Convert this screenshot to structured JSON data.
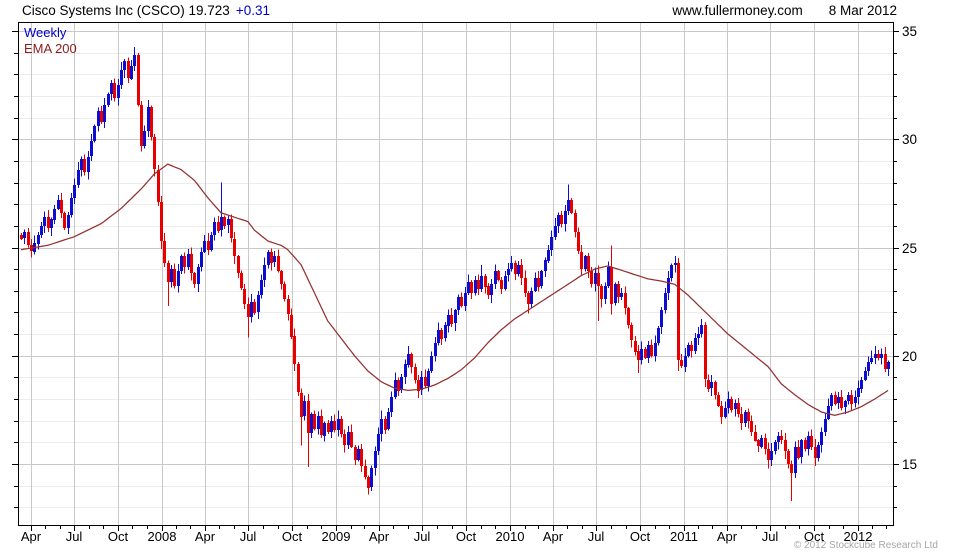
{
  "header": {
    "title": "Cisco Systems Inc (CSCO) 19.723",
    "change": "+0.31",
    "site": "www.fullermoney.com",
    "date": "8 Mar 2012"
  },
  "legend": {
    "timeframe": "Weekly",
    "indicator": "EMA 200"
  },
  "footer": {
    "copyright": "© 2012 Stockcube Research Ltd"
  },
  "colors": {
    "up": "#0d0dd2",
    "down": "#e80000",
    "ema": "#943030",
    "grid_major": "#c9c9c9",
    "grid_minor": "#ececec",
    "frame": "#000000",
    "axis_text": "#000000",
    "change_text": "#0000cc",
    "legend_weekly": "#0000cc",
    "legend_ema": "#8b1a1a",
    "copyright_text": "#a6a6a6"
  },
  "chart_data": {
    "type": "candlestick+line",
    "title": "Cisco Systems Inc (CSCO)",
    "last_price": 19.723,
    "change": 0.31,
    "frequency": "weekly",
    "start_date": "2007-03-12",
    "end_date": "2012-03-08",
    "ylim": [
      12.2,
      35.4
    ],
    "y_major_ticks": [
      15,
      20,
      25,
      30,
      35
    ],
    "y_minor_step": 1,
    "x_quarter_labels": [
      "Apr",
      "Jul",
      "Oct",
      "2008",
      "Apr",
      "Jul",
      "Oct",
      "2009",
      "Apr",
      "Jul",
      "Oct",
      "2010",
      "Apr",
      "Jul",
      "Oct",
      "2011",
      "Apr",
      "Jul",
      "Oct",
      "2012"
    ],
    "legend_series": [
      "Weekly",
      "EMA 200"
    ],
    "first_open": 25.6,
    "weekly_closes": [
      25.4,
      25.7,
      25.1,
      24.8,
      25.2,
      25.6,
      26.0,
      26.4,
      25.9,
      26.3,
      26.8,
      27.2,
      26.6,
      25.9,
      26.5,
      27.3,
      27.9,
      28.6,
      29.1,
      28.5,
      29.2,
      29.9,
      30.6,
      31.3,
      30.8,
      31.6,
      32.1,
      32.6,
      31.9,
      32.5,
      33.2,
      33.6,
      32.8,
      33.4,
      33.9,
      31.6,
      29.7,
      30.4,
      31.5,
      30.1,
      28.6,
      27.1,
      25.3,
      24.3,
      23.4,
      24.0,
      23.2,
      23.9,
      24.6,
      24.1,
      24.7,
      23.8,
      23.3,
      24.1,
      24.8,
      25.3,
      24.9,
      25.6,
      26.2,
      25.8,
      26.4,
      26.0,
      26.3,
      25.4,
      24.6,
      23.8,
      23.1,
      22.4,
      21.8,
      22.5,
      22.0,
      22.8,
      23.5,
      24.2,
      24.8,
      24.3,
      24.6,
      23.9,
      23.3,
      22.6,
      21.9,
      20.9,
      19.6,
      18.3,
      17.2,
      17.9,
      16.4,
      17.3,
      16.6,
      17.2,
      16.3,
      16.9,
      16.5,
      17.0,
      16.6,
      17.1,
      16.4,
      15.9,
      16.5,
      15.8,
      15.2,
      15.7,
      14.9,
      14.4,
      13.9,
      14.8,
      15.6,
      16.4,
      17.1,
      16.6,
      17.4,
      18.1,
      18.9,
      18.4,
      19.0,
      19.6,
      20.1,
      19.5,
      18.9,
      18.4,
      19.0,
      18.6,
      19.3,
      20.0,
      20.6,
      21.2,
      20.8,
      21.4,
      21.9,
      21.5,
      22.1,
      22.7,
      22.3,
      22.9,
      23.4,
      22.9,
      23.5,
      23.1,
      23.7,
      23.2,
      22.8,
      23.3,
      23.9,
      23.5,
      23.1,
      23.7,
      24.0,
      24.3,
      23.8,
      24.2,
      23.6,
      22.9,
      22.4,
      23.0,
      23.6,
      23.2,
      23.9,
      24.4,
      24.9,
      25.5,
      26.0,
      26.5,
      26.1,
      26.7,
      27.2,
      26.6,
      25.7,
      24.8,
      24.0,
      24.6,
      23.9,
      23.3,
      23.8,
      23.2,
      22.6,
      23.2,
      24.1,
      22.4,
      23.3,
      22.7,
      22.9,
      22.2,
      21.4,
      20.7,
      20.2,
      19.8,
      20.3,
      19.9,
      20.5,
      20.0,
      20.6,
      21.3,
      22.1,
      22.9,
      23.6,
      24.2,
      24.3,
      19.8,
      19.5,
      20.0,
      20.5,
      20.2,
      20.8,
      21.0,
      21.4,
      18.9,
      18.5,
      18.8,
      18.2,
      17.7,
      17.2,
      17.6,
      18.0,
      17.5,
      17.8,
      17.3,
      16.9,
      17.4,
      17.0,
      16.5,
      16.1,
      15.8,
      16.2,
      15.7,
      15.2,
      15.6,
      16.0,
      16.3,
      16.1,
      15.6,
      15.0,
      14.6,
      15.8,
      15.3,
      16.1,
      15.7,
      16.3,
      15.8,
      15.3,
      15.9,
      16.5,
      17.1,
      17.7,
      18.2,
      17.8,
      18.1,
      17.6,
      17.9,
      18.2,
      17.8,
      18.1,
      18.5,
      18.9,
      19.3,
      19.7,
      19.9,
      20.1,
      19.9,
      20.1,
      19.4,
      19.723
    ],
    "wick_overrides": {
      "34": {
        "h": 34.25
      },
      "44": {
        "l": 22.3
      },
      "60": {
        "h": 28.0
      },
      "68": {
        "l": 20.85
      },
      "84": {
        "l": 15.85
      },
      "86": {
        "l": 14.85
      },
      "104": {
        "l": 13.6
      },
      "116": {
        "h": 20.45
      },
      "138": {
        "h": 24.2
      },
      "147": {
        "h": 24.6
      },
      "152": {
        "l": 21.95
      },
      "164": {
        "h": 27.9
      },
      "173": {
        "l": 21.6
      },
      "177": {
        "h": 25.1,
        "l": 21.9
      },
      "185": {
        "l": 19.2
      },
      "196": {
        "h": 24.6
      },
      "197": {
        "l": 19.3
      },
      "204": {
        "h": 21.7
      },
      "205": {
        "l": 18.55
      },
      "210": {
        "l": 16.85
      },
      "224": {
        "l": 14.8
      },
      "231": {
        "l": 13.3
      },
      "238": {
        "l": 14.9
      },
      "256": {
        "h": 20.45
      }
    },
    "ema_keypoints": [
      [
        0,
        24.9
      ],
      [
        8,
        25.1
      ],
      [
        16,
        25.5
      ],
      [
        24,
        26.1
      ],
      [
        30,
        26.8
      ],
      [
        36,
        27.7
      ],
      [
        40,
        28.4
      ],
      [
        44,
        28.85
      ],
      [
        48,
        28.6
      ],
      [
        52,
        28.1
      ],
      [
        56,
        27.3
      ],
      [
        60,
        26.6
      ],
      [
        64,
        26.4
      ],
      [
        68,
        26.2
      ],
      [
        70,
        25.8
      ],
      [
        74,
        25.3
      ],
      [
        78,
        25.1
      ],
      [
        80,
        24.9
      ],
      [
        84,
        24.2
      ],
      [
        88,
        22.9
      ],
      [
        92,
        21.6
      ],
      [
        96,
        20.8
      ],
      [
        100,
        20.0
      ],
      [
        104,
        19.3
      ],
      [
        108,
        18.8
      ],
      [
        112,
        18.5
      ],
      [
        116,
        18.4
      ],
      [
        120,
        18.45
      ],
      [
        124,
        18.65
      ],
      [
        128,
        18.95
      ],
      [
        132,
        19.35
      ],
      [
        136,
        19.9
      ],
      [
        140,
        20.6
      ],
      [
        144,
        21.2
      ],
      [
        148,
        21.7
      ],
      [
        152,
        22.1
      ],
      [
        156,
        22.5
      ],
      [
        160,
        22.9
      ],
      [
        164,
        23.3
      ],
      [
        168,
        23.7
      ],
      [
        172,
        24.0
      ],
      [
        176,
        24.15
      ],
      [
        180,
        23.95
      ],
      [
        184,
        23.75
      ],
      [
        188,
        23.55
      ],
      [
        192,
        23.45
      ],
      [
        196,
        23.3
      ],
      [
        200,
        22.8
      ],
      [
        204,
        22.2
      ],
      [
        208,
        21.6
      ],
      [
        212,
        21.0
      ],
      [
        216,
        20.5
      ],
      [
        220,
        20.0
      ],
      [
        224,
        19.5
      ],
      [
        228,
        18.7
      ],
      [
        232,
        18.2
      ],
      [
        236,
        17.75
      ],
      [
        240,
        17.4
      ],
      [
        244,
        17.25
      ],
      [
        248,
        17.4
      ],
      [
        252,
        17.65
      ],
      [
        256,
        18.0
      ],
      [
        260,
        18.4
      ]
    ]
  }
}
